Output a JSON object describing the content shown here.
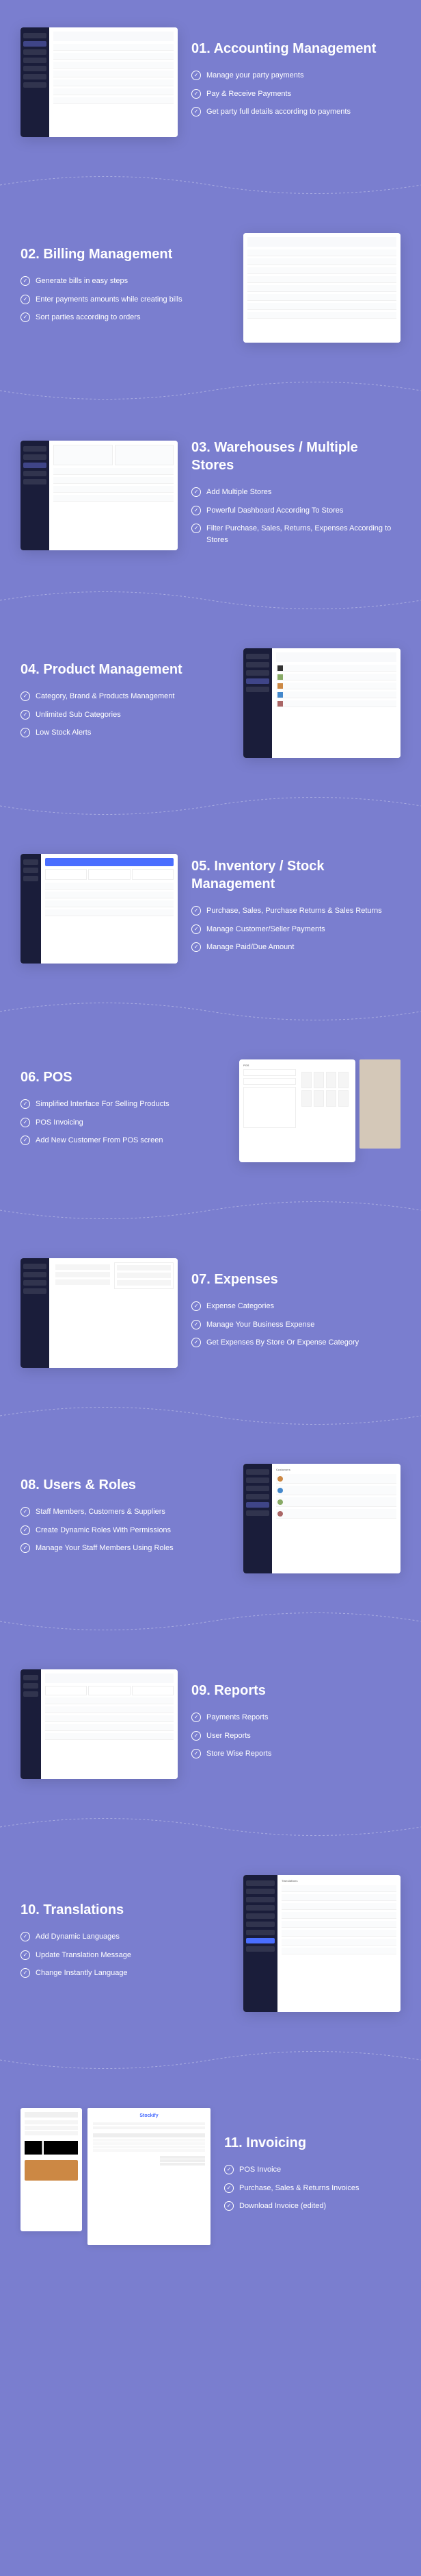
{
  "sections": [
    {
      "id": "01",
      "title": "01. Accounting Management",
      "features": [
        "Manage your party payments",
        "Pay & Receive Payments",
        "Get party full details according to payments"
      ],
      "imagePosition": "left"
    },
    {
      "id": "02",
      "title": "02. Billing Management",
      "features": [
        "Generate bills in easy steps",
        "Enter payments amounts while creating bills",
        "Sort parties according to orders"
      ],
      "imagePosition": "right"
    },
    {
      "id": "03",
      "title": "03. Warehouses / Multiple Stores",
      "features": [
        "Add Multiple Stores",
        "Powerful Dashboard According To Stores",
        "Filter Purchase, Sales, Returns, Expenses According to Stores"
      ],
      "imagePosition": "left"
    },
    {
      "id": "04",
      "title": "04. Product Management",
      "features": [
        "Category, Brand & Products Management",
        "Unlimited Sub Categories",
        "Low Stock Alerts"
      ],
      "imagePosition": "right"
    },
    {
      "id": "05",
      "title": "05. Inventory / Stock Management",
      "features": [
        "Purchase, Sales, Purchase Returns & Sales Returns",
        "Manage Customer/Seller Payments",
        "Manage Paid/Due Amount"
      ],
      "imagePosition": "left"
    },
    {
      "id": "06",
      "title": "06. POS",
      "features": [
        "Simplified Interface For Selling Products",
        "POS Invoicing",
        "Add New Customer From POS screen"
      ],
      "imagePosition": "right"
    },
    {
      "id": "07",
      "title": "07. Expenses",
      "features": [
        "Expense Categories",
        "Manage Your Business Expense",
        "Get Expenses By Store Or Expense Category"
      ],
      "imagePosition": "left"
    },
    {
      "id": "08",
      "title": "08. Users & Roles",
      "features": [
        "Staff Members, Customers & Suppliers",
        "Create Dynamic Roles With Permissions",
        "Manage Your Staff Members Using Roles"
      ],
      "imagePosition": "right"
    },
    {
      "id": "09",
      "title": "09. Reports",
      "features": [
        "Payments Reports",
        "User Reports",
        "Store Wise Reports"
      ],
      "imagePosition": "left"
    },
    {
      "id": "10",
      "title": "10. Translations",
      "features": [
        "Add Dynamic Languages",
        "Update Translation Message",
        "Change Instantly Language"
      ],
      "imagePosition": "right"
    },
    {
      "id": "11",
      "title": "11. Invoicing",
      "features": [
        "POS Invoice",
        "Purchase, Sales & Returns Invoices",
        "Download Invoice (edited)"
      ],
      "imagePosition": "left"
    }
  ],
  "mockups": {
    "pos_label": "POS",
    "customers_label": "Customers",
    "translations_label": "Translations",
    "invoice_brand": "Stockify"
  }
}
